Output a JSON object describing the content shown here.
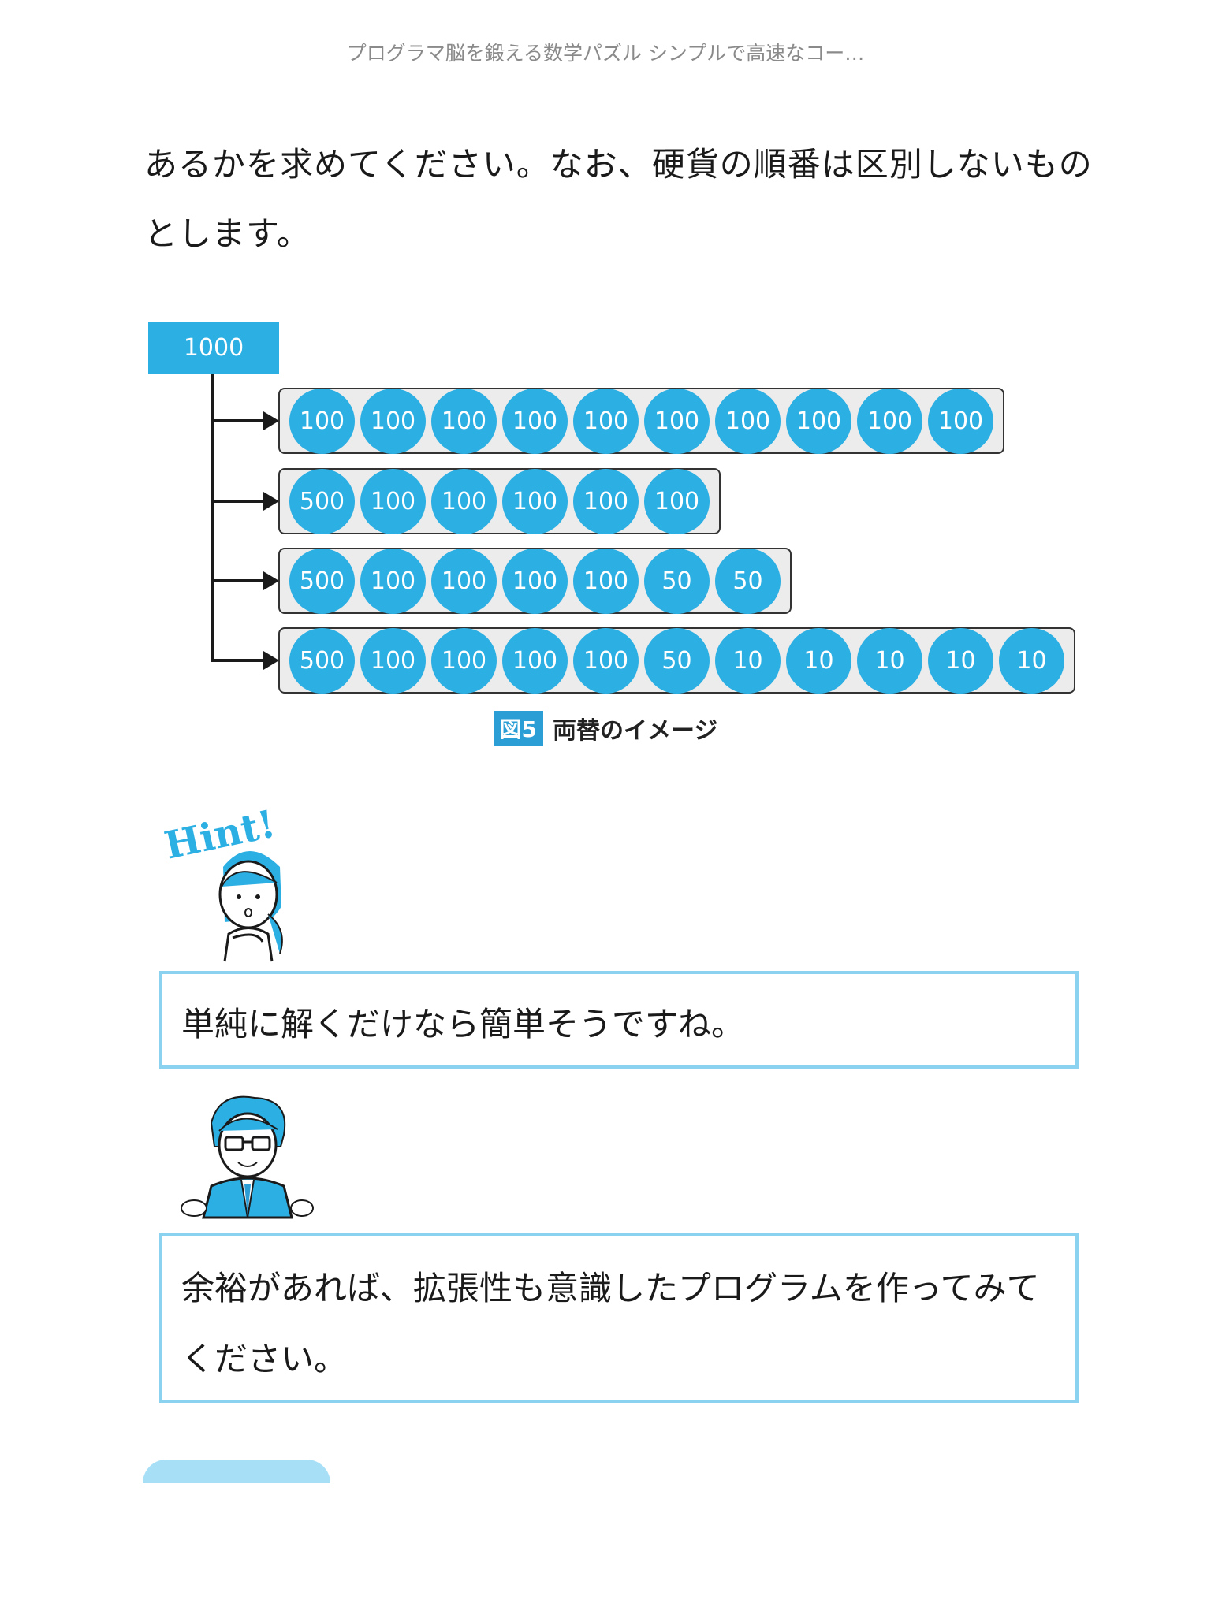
{
  "header": {
    "title": "プログラマ脳を鍛える数学パズル シンプルで高速なコー…"
  },
  "paragraph": {
    "lines": [
      "あるかを求めてください。なお、硬貨の順番は区別しないもの",
      "とします。"
    ]
  },
  "figure": {
    "root": "1000",
    "rows": [
      [
        "100",
        "100",
        "100",
        "100",
        "100",
        "100",
        "100",
        "100",
        "100",
        "100"
      ],
      [
        "500",
        "100",
        "100",
        "100",
        "100",
        "100"
      ],
      [
        "500",
        "100",
        "100",
        "100",
        "100",
        "50",
        "50"
      ],
      [
        "500",
        "100",
        "100",
        "100",
        "100",
        "50",
        "10",
        "10",
        "10",
        "10",
        "10"
      ]
    ],
    "caption_label": "図5",
    "caption_text": "両替のイメージ"
  },
  "hint": {
    "badge": "Hint!"
  },
  "bubbles": {
    "first": {
      "lines": [
        "単純に解くだけなら簡単そうですね。"
      ]
    },
    "second": {
      "lines": [
        "余裕があれば、拡張性も意識したプログラムを作ってみて",
        "ください。"
      ]
    }
  },
  "colors": {
    "coin": "#2cafe3",
    "bubble_border": "#8ad2ef",
    "tab": "#a7dff7"
  }
}
